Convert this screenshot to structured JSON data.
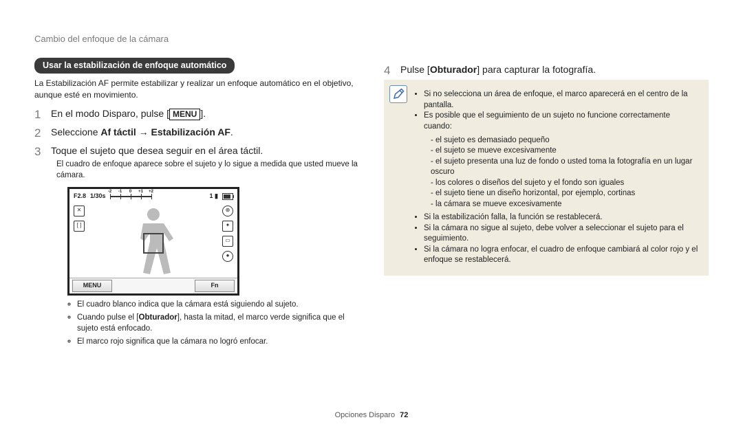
{
  "breadcrumb": "Cambio del enfoque de la cámara",
  "left": {
    "pill": "Usar la estabilización de enfoque automático",
    "intro": "La Estabilización AF permite estabilizar y realizar un enfoque automático en el objetivo, aunque esté en movimiento.",
    "step1_pre": "En el modo Disparo, pulse [",
    "step1_menu": "MENU",
    "step1_post": "].",
    "step2_pre": "Seleccione ",
    "step2_b1": "Af táctil",
    "step2_arrow": " → ",
    "step2_b2": "Estabilización AF",
    "step2_post": ".",
    "step3": "Toque el sujeto que desea seguir en el área táctil.",
    "step3_sub": "El cuadro de enfoque aparece sobre el sujeto y lo sigue a medida que usted mueve la cámara.",
    "camera": {
      "f": "F2.8",
      "s": "1/30s",
      "btn_left": "MENU",
      "btn_right": "Fn"
    },
    "bullets": {
      "b1": "El cuadro blanco indica que la cámara está siguiendo al sujeto.",
      "b2_pre": "Cuando pulse el [",
      "b2_b": "Obturador",
      "b2_post": "], hasta la mitad, el marco verde significa que el sujeto está enfocado.",
      "b3": "El marco rojo significa que la cámara no logró enfocar."
    }
  },
  "right": {
    "step4_pre": "Pulse [",
    "step4_b": "Obturador",
    "step4_post": "] para capturar la fotografía.",
    "note": {
      "l1": "Si no selecciona un área de enfoque, el marco aparecerá en el centro de la pantalla.",
      "l2": "Es posible que el seguimiento de un sujeto no funcione correctamente cuando:",
      "d1": "el sujeto es demasiado pequeño",
      "d2": "el sujeto se mueve excesivamente",
      "d3": "el sujeto presenta una luz de fondo o usted toma la fotografía en un lugar oscuro",
      "d4": "los colores o diseños del sujeto y el fondo son iguales",
      "d5": "el sujeto tiene un diseño horizontal, por ejemplo, cortinas",
      "d6": "la cámara se mueve excesivamente",
      "l3": "Si la estabilización falla, la función se restablecerá.",
      "l4": "Si la cámara no sigue al sujeto, debe volver a seleccionar el sujeto para el seguimiento.",
      "l5": "Si la cámara no logra enfocar, el cuadro de enfoque cambiará al color rojo y el enfoque se restablecerá."
    }
  },
  "footer": {
    "label": "Opciones Disparo",
    "page": "72"
  }
}
